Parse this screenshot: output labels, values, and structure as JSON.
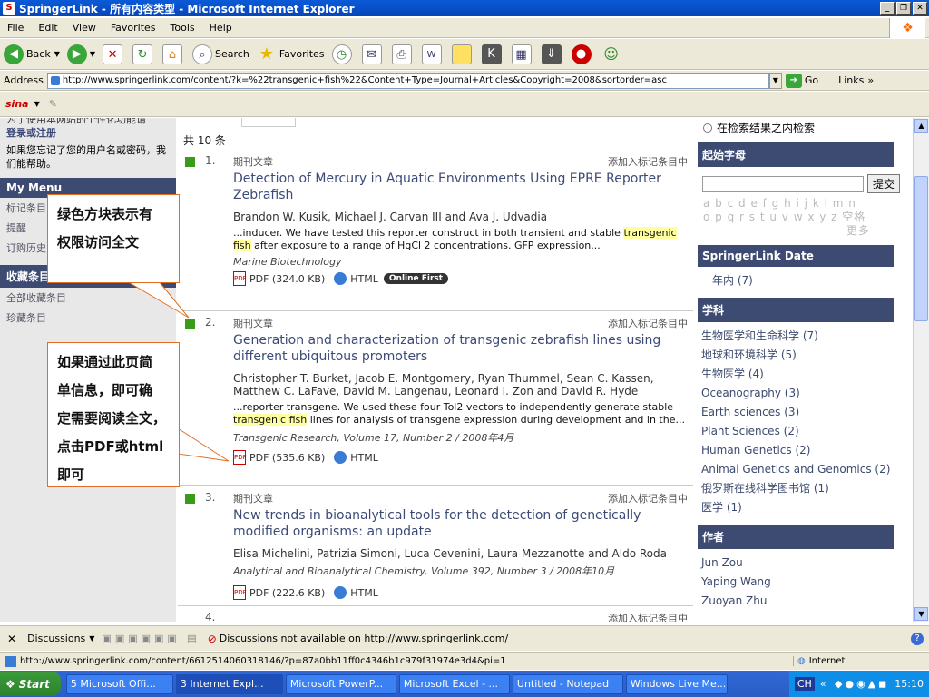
{
  "window": {
    "title": "SpringerLink - 所有内容类型 - Microsoft Internet Explorer"
  },
  "menu": [
    "File",
    "Edit",
    "View",
    "Favorites",
    "Tools",
    "Help"
  ],
  "toolbar": {
    "back": "Back",
    "search": "Search",
    "favorites": "Favorites"
  },
  "address": {
    "label": "Address",
    "url": "http://www.springerlink.com/content/?k=%22transgenic+fish%22&Content+Type=Journal+Articles&Copyright=2008&sortorder=asc",
    "go": "Go",
    "links": "Links"
  },
  "sina": "sina",
  "left": {
    "partial_text": "为了使用本网站的个性化功能请",
    "login_link": "登录或注册",
    "forgot_text": "如果您忘记了您的用户名或密码，我们能帮助。",
    "my_menu_header": "My Menu",
    "my_menu_items": [
      "标记条目",
      "提醒",
      "订购历史"
    ],
    "favorites_header": "收藏条目",
    "favorites_items": [
      "全部收藏条目",
      "珍藏条目"
    ]
  },
  "results": {
    "count": "共 10 条",
    "items": [
      {
        "num": "1.",
        "type": "期刊文章",
        "add": "添加入标记条目中",
        "title": "Detection of Mercury in Aquatic Environments Using EPRE Reporter Zebrafish",
        "authors": "Brandon W. Kusik, Michael J. Carvan III and Ava J. Udvadia",
        "snippet_pre": "...inducer. We have tested this reporter construct in both transient and stable",
        "snippet_hl": "transgenic fish",
        "snippet_post": "after exposure to a range of HgCl 2 concentrations. GFP expression...",
        "source": "Marine Biotechnology",
        "pdf": "PDF (324.0 KB)",
        "html": "HTML",
        "badge": "Online First"
      },
      {
        "num": "2.",
        "type": "期刊文章",
        "add": "添加入标记条目中",
        "title": "Generation and characterization of transgenic zebrafish lines using different ubiquitous promoters",
        "authors": "Christopher T. Burket, Jacob E. Montgomery, Ryan Thummel, Sean C. Kassen, Matthew C. LaFave, David M. Langenau, Leonard I. Zon and David R. Hyde",
        "snippet_pre": "...reporter transgene. We used these four Tol2 vectors to independently generate stable",
        "snippet_hl": "transgenic fish",
        "snippet_post": "lines for analysis of transgene expression during development and in the...",
        "source": "Transgenic Research, Volume 17, Number 2 / 2008年4月",
        "pdf": "PDF (535.6 KB)",
        "html": "HTML"
      },
      {
        "num": "3.",
        "type": "期刊文章",
        "add": "添加入标记条目中",
        "title": "New trends in bioanalytical tools for the detection of genetically modified organisms: an update",
        "authors": "Elisa Michelini, Patrizia Simoni, Luca Cevenini, Laura Mezzanotte and Aldo Roda",
        "source": "Analytical and Bioanalytical Chemistry, Volume 392, Number 3 / 2008年10月",
        "pdf": "PDF (222.6 KB)",
        "html": "HTML"
      },
      {
        "num": "4.",
        "add": "添加入标记条目中"
      }
    ]
  },
  "right": {
    "search_within": "在检索结果之内检索",
    "alpha_header": "起始字母",
    "submit": "提交",
    "alpha_row1": "a b c d e f g h i j k l m n",
    "alpha_row2": "o p q r s t u v w x y z 空格",
    "alpha_more": "更多",
    "date_header": "SpringerLink Date",
    "date_items": [
      "一年内 (7)"
    ],
    "subject_header": "学科",
    "subject_items": [
      "生物医学和生命科学 (7)",
      "地球和环境科学 (5)",
      "生物医学 (4)",
      "Oceanography (3)",
      "Earth sciences (3)",
      "Plant Sciences (2)",
      "Human Genetics (2)",
      "Animal Genetics and Genomics (2)",
      "俄罗斯在线科学图书馆 (1)",
      "医学 (1)"
    ],
    "author_header": "作者",
    "author_items": [
      "Jun Zou",
      "Yaping Wang",
      "Zuoyan Zhu"
    ]
  },
  "callouts": {
    "c1": [
      "绿色方块表示有",
      "权限访问全文"
    ],
    "c2": [
      "如果通过此页简",
      "单信息，即可确",
      "定需要阅读全文，",
      "点击PDF或html",
      "即可"
    ]
  },
  "discussions": {
    "label": "Discussions",
    "msg": "Discussions not available on http://www.springerlink.com/"
  },
  "status": {
    "url": "http://www.springerlink.com/content/6612514060318146/?p=87a0bb11ff0c4346b1c979f31974e3d4&pi=1",
    "zone": "Internet"
  },
  "taskbar": {
    "start": "Start",
    "tasks": [
      "5 Microsoft Offi...",
      "3 Internet Expl...",
      "Microsoft PowerP...",
      "Microsoft Excel - ...",
      "Untitled - Notepad",
      "Windows Live Me..."
    ],
    "lang": "CH",
    "clock": "15:10"
  }
}
